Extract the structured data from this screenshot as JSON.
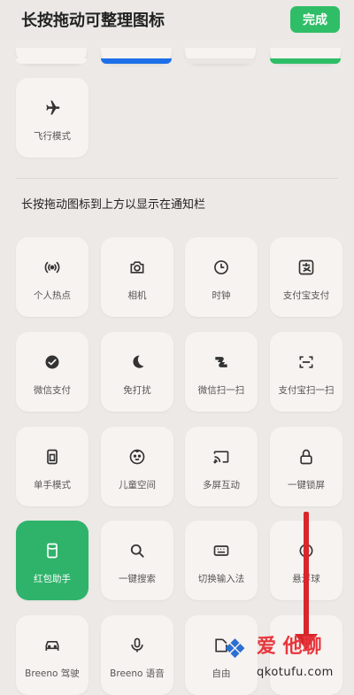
{
  "header": {
    "title": "长按拖动可整理图标",
    "done_label": "完成"
  },
  "partial_tiles": [
    {
      "accent": "#f6f3f1"
    },
    {
      "accent": "#1f6fe8"
    },
    {
      "accent": "#e9e6e3"
    },
    {
      "accent": "#2fbe67"
    }
  ],
  "active_tiles": [
    {
      "label": "飞行模式",
      "icon": "airplane-icon"
    }
  ],
  "section_label": "长按拖动图标到上方以显示在通知栏",
  "tiles": [
    {
      "label": "个人热点",
      "icon": "hotspot-icon",
      "active": false
    },
    {
      "label": "相机",
      "icon": "camera-icon",
      "active": false
    },
    {
      "label": "时钟",
      "icon": "clock-icon",
      "active": false
    },
    {
      "label": "支付宝支付",
      "icon": "alipay-icon",
      "active": false
    },
    {
      "label": "微信支付",
      "icon": "wechat-pay-icon",
      "active": false
    },
    {
      "label": "免打扰",
      "icon": "moon-icon",
      "active": false
    },
    {
      "label": "微信扫一扫",
      "icon": "wechat-scan-icon",
      "active": false
    },
    {
      "label": "支付宝扫一扫",
      "icon": "scan-icon",
      "active": false
    },
    {
      "label": "单手模式",
      "icon": "one-hand-icon",
      "active": false
    },
    {
      "label": "儿童空间",
      "icon": "child-face-icon",
      "active": false
    },
    {
      "label": "多屏互动",
      "icon": "cast-icon",
      "active": false
    },
    {
      "label": "一键锁屏",
      "icon": "lock-icon",
      "active": false
    },
    {
      "label": "红包助手",
      "icon": "red-packet-icon",
      "active": true
    },
    {
      "label": "一键搜索",
      "icon": "search-icon",
      "active": false
    },
    {
      "label": "切换输入法",
      "icon": "keyboard-icon",
      "active": false
    },
    {
      "label": "悬浮球",
      "icon": "float-ball-icon",
      "active": false
    },
    {
      "label": "Breeno 驾驶",
      "icon": "car-icon",
      "active": false
    },
    {
      "label": "Breeno 语音",
      "icon": "mic-icon",
      "active": false
    },
    {
      "label": "自由",
      "icon": "window-icon",
      "active": false
    },
    {
      "label": "",
      "icon": "blank-icon",
      "active": false
    }
  ],
  "colors": {
    "accent": "#2fbe67",
    "annotation_arrow": "#d8262d"
  },
  "watermark": {
    "line1": "爱 他聊",
    "line2": "qkotufu.com"
  }
}
